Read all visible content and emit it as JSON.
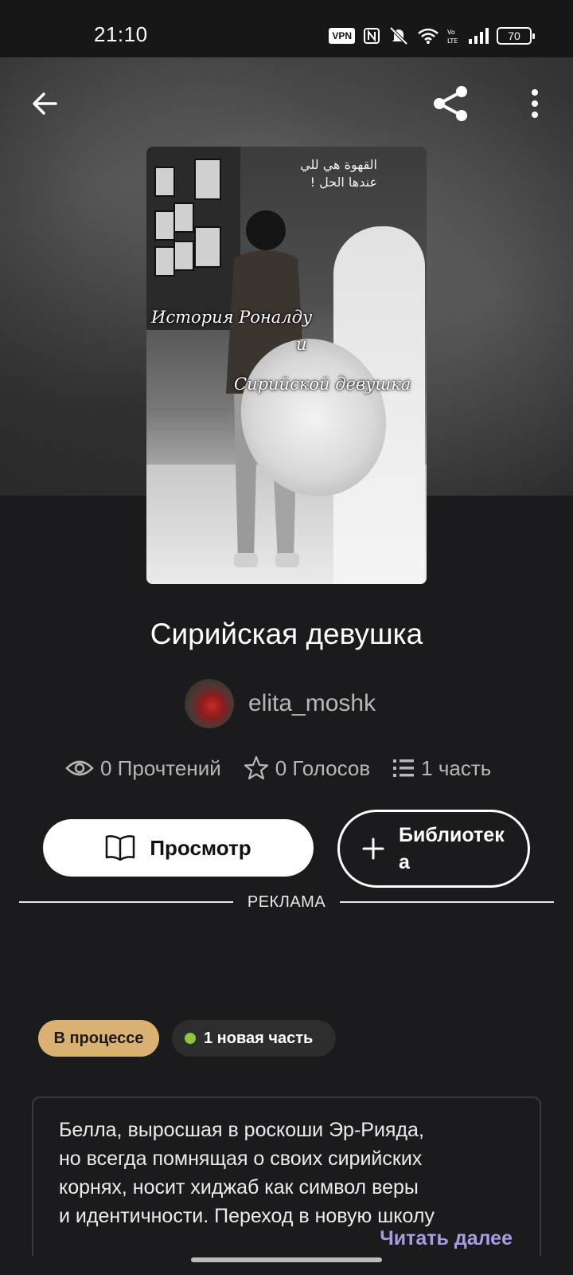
{
  "status_bar": {
    "time": "21:10",
    "vpn_label": "VPN",
    "battery": "70",
    "icons": [
      "vpn-icon",
      "nfc-icon",
      "mute-icon",
      "wifi-icon",
      "volte-icon",
      "signal-icon",
      "battery-icon"
    ]
  },
  "topbar": {
    "icons": [
      "back-arrow-icon",
      "share-icon",
      "more-vertical-icon"
    ]
  },
  "cover": {
    "arabic_text_line1": "القهوة هي للي",
    "arabic_text_line2": "عندها الحل !",
    "overlay_line1": "История Роналду",
    "overlay_line2": "и",
    "overlay_line3": "Сирийской девушка"
  },
  "story": {
    "title": "Сирийская девушка",
    "author": "elita_moshk"
  },
  "stats": {
    "reads": "0 Прочтений",
    "votes": "0 Голосов",
    "parts": "1 часть"
  },
  "actions": {
    "view_label": "Просмотр",
    "library_label": "Библиотека"
  },
  "ad": {
    "label": "РЕКЛАМА"
  },
  "chips": {
    "status": "В процессе",
    "new_part": "1 новая часть"
  },
  "description": {
    "line1": "Белла, выросшая в роскоши Эр-Рияда,",
    "line2": "но всегда помнящая о своих сирийских",
    "line3": "корнях, носит хиджаб как символ веры",
    "line4": "и идентичности. Переход в новую школу",
    "read_more": "Читать далее"
  },
  "colors": {
    "background": "#1b1a1c",
    "status_chip": "#d9b273",
    "new_dot": "#8cc63f",
    "read_more": "#a99be4"
  }
}
